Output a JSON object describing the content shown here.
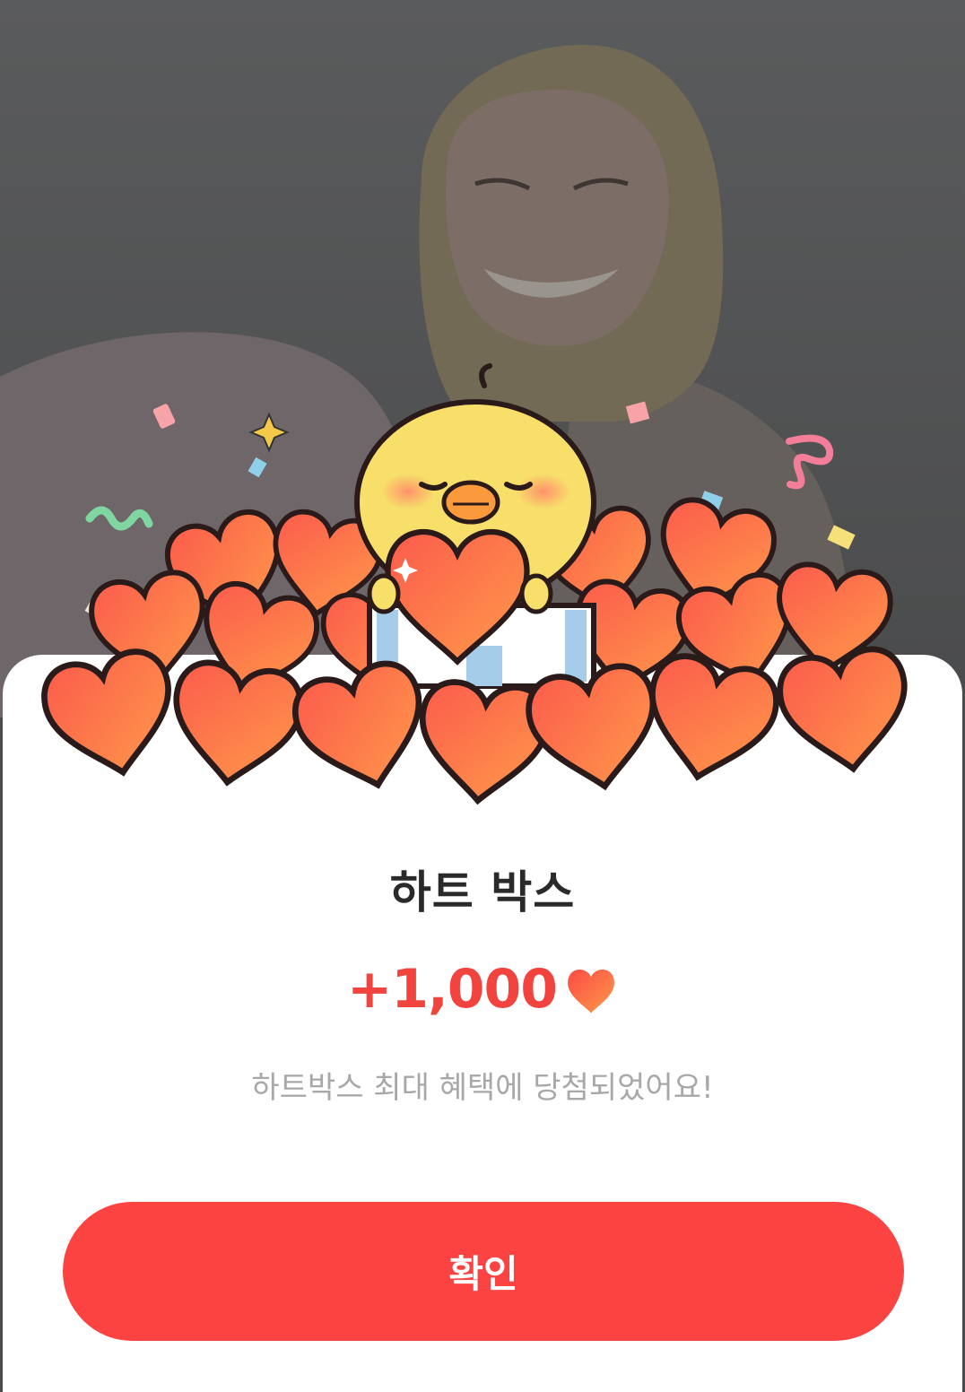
{
  "dialog": {
    "title": "하트 박스",
    "reward_amount": "+1,000",
    "reward_icon": "heart-icon",
    "message": "하트박스 최대 혜택에 당첨되었어요!",
    "confirm_label": "확인"
  },
  "colors": {
    "accent": "#fb4341",
    "reward_text": "#f2443f",
    "title_text": "#2a2a2a",
    "message_text": "#a8a8a8",
    "backdrop": "#4b4c4d"
  }
}
